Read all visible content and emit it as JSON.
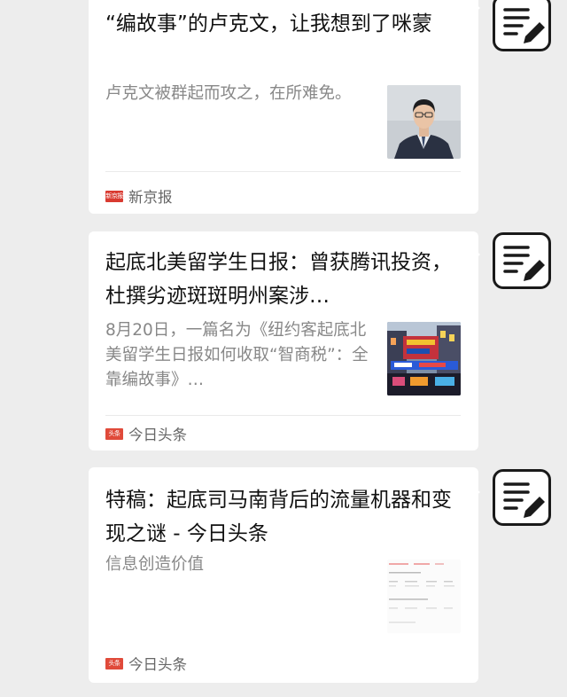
{
  "cards": [
    {
      "title": "“编故事”的卢克文，让我想到了咪蒙",
      "summary": "卢克文被群起而攻之，在所难免。",
      "source": {
        "logo_text": "新京报",
        "name": "新京报",
        "logo_color": "#d93a30"
      },
      "thumbnail_icon": "portrait-photo"
    },
    {
      "title": "起底北美留学生日报：曾获腾讯投资，杜撰劣迹斑斑明州案涉…",
      "summary": "8月20日，一篇名为《纽约客起底北美留学生日报如何收取“智商税”：全靠编故事》…",
      "source": {
        "logo_text": "头条",
        "name": "今日头条",
        "logo_color": "#e04a3a"
      },
      "thumbnail_icon": "city-street-photo"
    },
    {
      "title": "特稿：起底司马南背后的流量机器和变现之谜 - 今日头条",
      "summary": "信息创造价值",
      "source": {
        "logo_text": "头条",
        "name": "今日头条",
        "logo_color": "#e04a3a"
      },
      "thumbnail_icon": "document-table-screenshot"
    }
  ],
  "edit_icon": "notepad-pencil-icon"
}
